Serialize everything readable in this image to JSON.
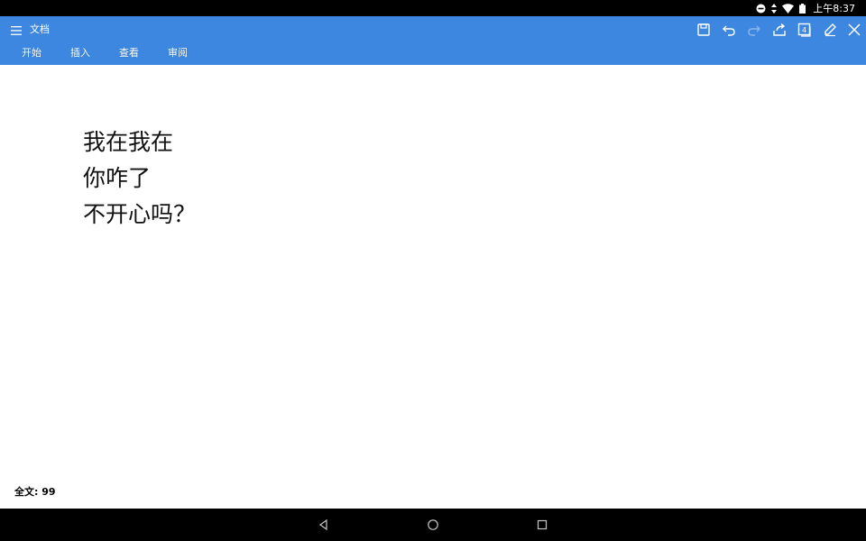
{
  "status_bar": {
    "time": "上午8:37",
    "icons": [
      "do-not-disturb-icon",
      "data-arrows-icon",
      "wifi-icon",
      "battery-icon"
    ]
  },
  "app_bar": {
    "color": "#3d87e0",
    "title": "文档",
    "tabs": [
      {
        "label": "开始"
      },
      {
        "label": "插入"
      },
      {
        "label": "查看"
      },
      {
        "label": "审阅"
      }
    ],
    "toolbar_icons": [
      "save-icon",
      "undo-icon",
      "redo-icon",
      "share-icon",
      "page-count-icon",
      "edit-icon",
      "close-icon"
    ],
    "page_count": "4"
  },
  "document": {
    "lines": [
      "我在我在",
      "你咋了",
      "不开心吗？"
    ]
  },
  "footer": {
    "word_count": "全文: 99"
  },
  "nav_bar": {
    "icons": [
      "back-icon",
      "home-icon",
      "recents-icon"
    ]
  }
}
